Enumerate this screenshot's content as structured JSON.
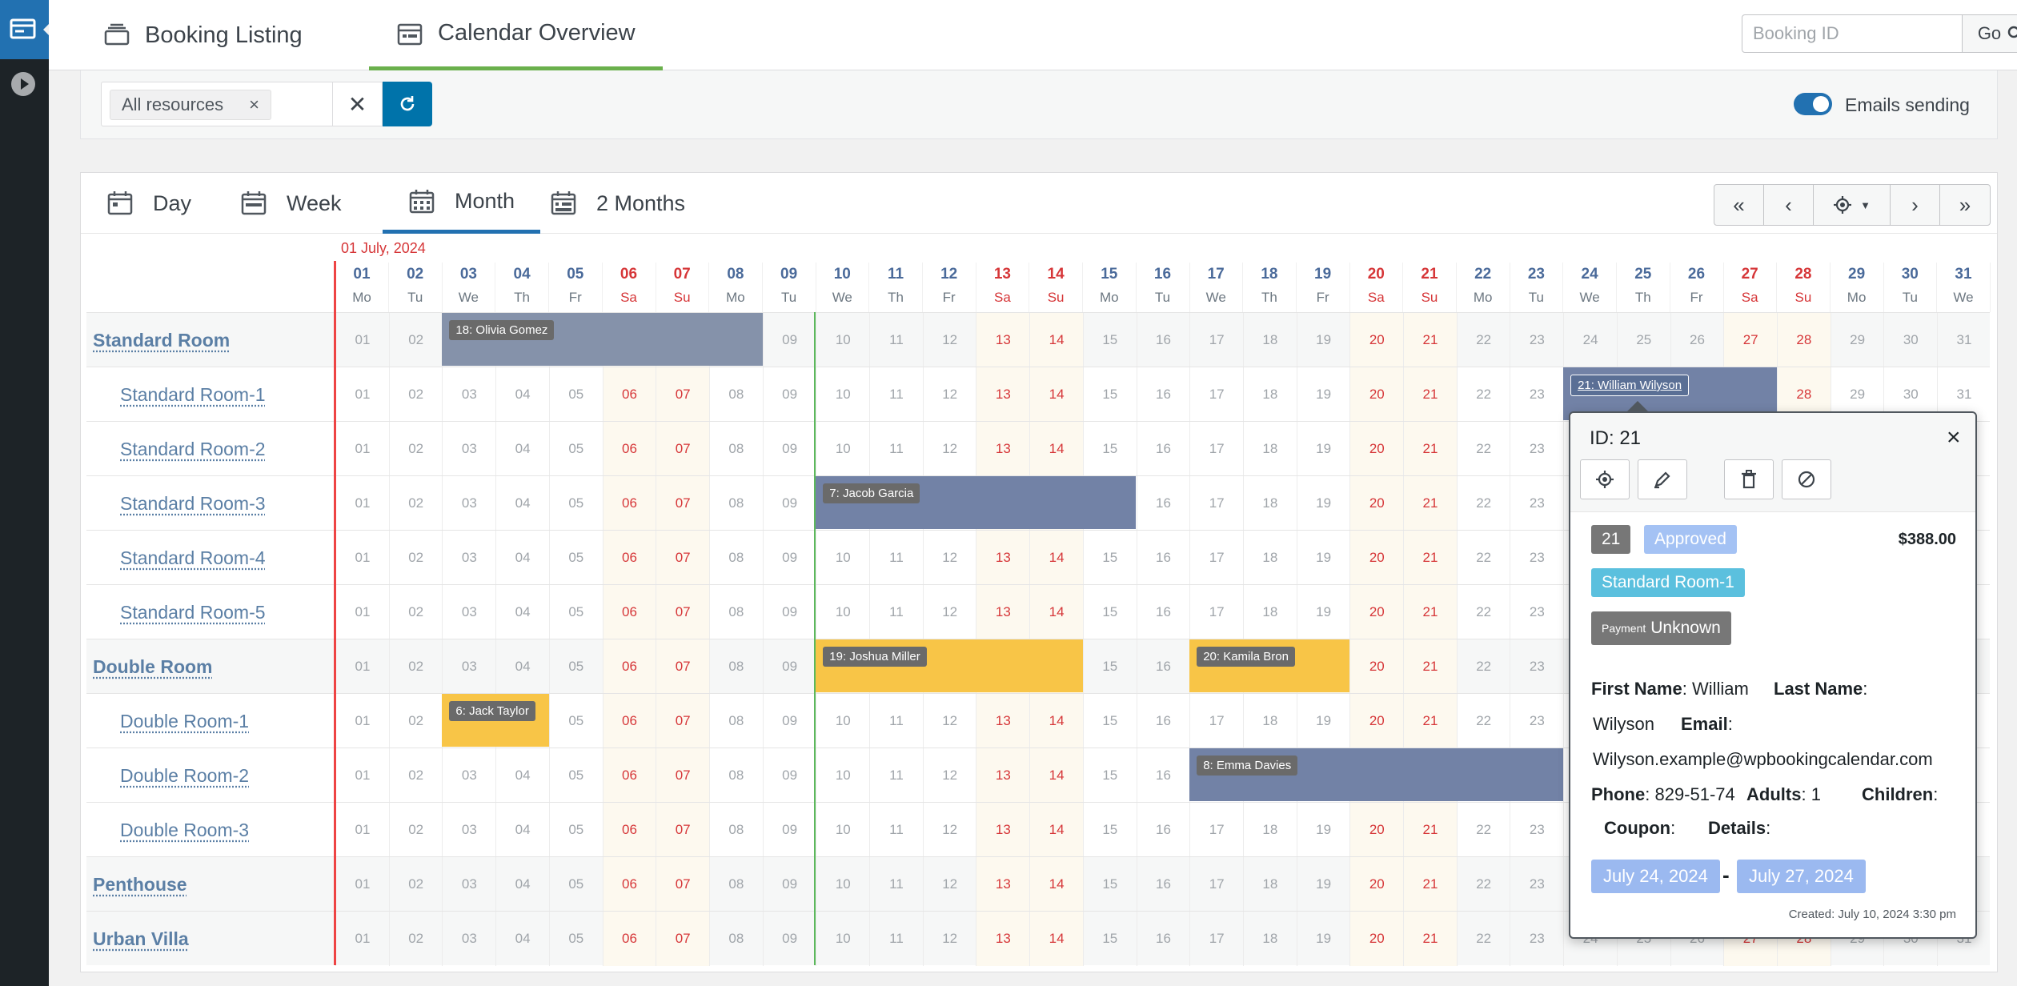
{
  "top_tabs": {
    "booking_listing": "Booking Listing",
    "calendar_overview": "Calendar Overview"
  },
  "search": {
    "placeholder": "Booking ID",
    "go_label": "Go"
  },
  "filter": {
    "resource_tag": "All resources",
    "emails_label": "Emails sending",
    "emails_enabled": true
  },
  "view_tabs": {
    "day": "Day",
    "week": "Week",
    "month": "Month",
    "two_months": "2 Months",
    "active": "Month"
  },
  "calendar": {
    "month_label": "01 July, 2024",
    "days": [
      {
        "n": "01",
        "w": "Mo"
      },
      {
        "n": "02",
        "w": "Tu"
      },
      {
        "n": "03",
        "w": "We"
      },
      {
        "n": "04",
        "w": "Th"
      },
      {
        "n": "05",
        "w": "Fr"
      },
      {
        "n": "06",
        "w": "Sa"
      },
      {
        "n": "07",
        "w": "Su"
      },
      {
        "n": "08",
        "w": "Mo"
      },
      {
        "n": "09",
        "w": "Tu"
      },
      {
        "n": "10",
        "w": "We"
      },
      {
        "n": "11",
        "w": "Th"
      },
      {
        "n": "12",
        "w": "Fr"
      },
      {
        "n": "13",
        "w": "Sa"
      },
      {
        "n": "14",
        "w": "Su"
      },
      {
        "n": "15",
        "w": "Mo"
      },
      {
        "n": "16",
        "w": "Tu"
      },
      {
        "n": "17",
        "w": "We"
      },
      {
        "n": "18",
        "w": "Th"
      },
      {
        "n": "19",
        "w": "Fr"
      },
      {
        "n": "20",
        "w": "Sa"
      },
      {
        "n": "21",
        "w": "Su"
      },
      {
        "n": "22",
        "w": "Mo"
      },
      {
        "n": "23",
        "w": "Tu"
      },
      {
        "n": "24",
        "w": "We"
      },
      {
        "n": "25",
        "w": "Th"
      },
      {
        "n": "26",
        "w": "Fr"
      },
      {
        "n": "27",
        "w": "Sa"
      },
      {
        "n": "28",
        "w": "Su"
      },
      {
        "n": "29",
        "w": "Mo"
      },
      {
        "n": "30",
        "w": "Tu"
      },
      {
        "n": "31",
        "w": "We"
      }
    ],
    "resources": [
      {
        "name": "Standard Room",
        "type": "parent"
      },
      {
        "name": "Standard Room-1",
        "type": "child"
      },
      {
        "name": "Standard Room-2",
        "type": "child"
      },
      {
        "name": "Standard Room-3",
        "type": "child"
      },
      {
        "name": "Standard Room-4",
        "type": "child"
      },
      {
        "name": "Standard Room-5",
        "type": "child"
      },
      {
        "name": "Double Room",
        "type": "parent"
      },
      {
        "name": "Double Room-1",
        "type": "child"
      },
      {
        "name": "Double Room-2",
        "type": "child"
      },
      {
        "name": "Double Room-3",
        "type": "child"
      },
      {
        "name": "Penthouse",
        "type": "parent"
      },
      {
        "name": "Urban Villa",
        "type": "parent"
      }
    ],
    "bookings": [
      {
        "row": 0,
        "start": 3,
        "end": 8,
        "label": "18: Olivia Gomez",
        "color": "#8592aa"
      },
      {
        "row": 1,
        "start": 24,
        "end": 27,
        "label": "21: William Wilyson",
        "color": "#7282a6",
        "selected": true
      },
      {
        "row": 3,
        "start": 10,
        "end": 15,
        "label": "7: Jacob Garcia",
        "color": "#7282a6"
      },
      {
        "row": 6,
        "start": 10,
        "end": 14,
        "label": "19: Joshua Miller",
        "color": "#f8c547"
      },
      {
        "row": 6,
        "start": 17,
        "end": 19,
        "label": "20: Kamila Bron",
        "color": "#f8c547"
      },
      {
        "row": 7,
        "start": 3,
        "end": 4,
        "label": "6: Jack Taylor",
        "color": "#f8c547"
      },
      {
        "row": 8,
        "start": 17,
        "end": 23,
        "label": "8: Emma Davies",
        "color": "#7282a6"
      }
    ]
  },
  "popover": {
    "title": "ID: 21",
    "id_badge": "21",
    "status": "Approved",
    "cost": "$388.00",
    "resource": "Standard Room-1",
    "payment_prefix": "Payment",
    "payment_status": "Unknown",
    "first_name_label": "First Name",
    "first_name": "William",
    "last_name_label": "Last Name",
    "last_name": "Wilyson",
    "email_label": "Email",
    "email": "Wilyson.example@wpbookingcalendar.com",
    "phone_label": "Phone",
    "phone": "829-51-74",
    "adults_label": "Adults",
    "adults": "1",
    "children_label": "Children",
    "coupon_label": "Coupon",
    "details_label": "Details",
    "date_from": "July 24, 2024",
    "date_sep": "-",
    "date_to": "July 27, 2024",
    "created": "Created: July 10, 2024 3:30 pm",
    "colors": {
      "approved": "#a4c2f4",
      "resource": "#5bc0de",
      "gray": "#777777",
      "date": "#9bb9f0"
    }
  }
}
